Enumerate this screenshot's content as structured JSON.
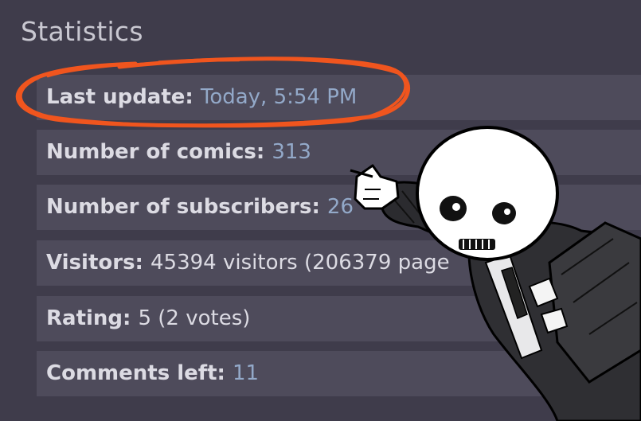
{
  "title": "Statistics",
  "rows": [
    {
      "label": "Last update:",
      "value": "Today, 5:54 PM",
      "is_link": true
    },
    {
      "label": "Number of comics:",
      "value": "313",
      "is_link": true
    },
    {
      "label": "Number of subscribers:",
      "value": "26",
      "is_link": true
    },
    {
      "label": "Visitors:",
      "value": "45394 visitors (206379 page",
      "is_link": false
    },
    {
      "label": "Rating:",
      "value": "5 (2 votes)",
      "is_link": false
    },
    {
      "label": "Comments left:",
      "value": "11",
      "is_link": true
    }
  ],
  "colors": {
    "background": "#3f3c4b",
    "row_background": "#4e4b5b",
    "label_text": "#dcdbe3",
    "link_text": "#93a9c9",
    "highlight_circle": "#f0551e"
  }
}
